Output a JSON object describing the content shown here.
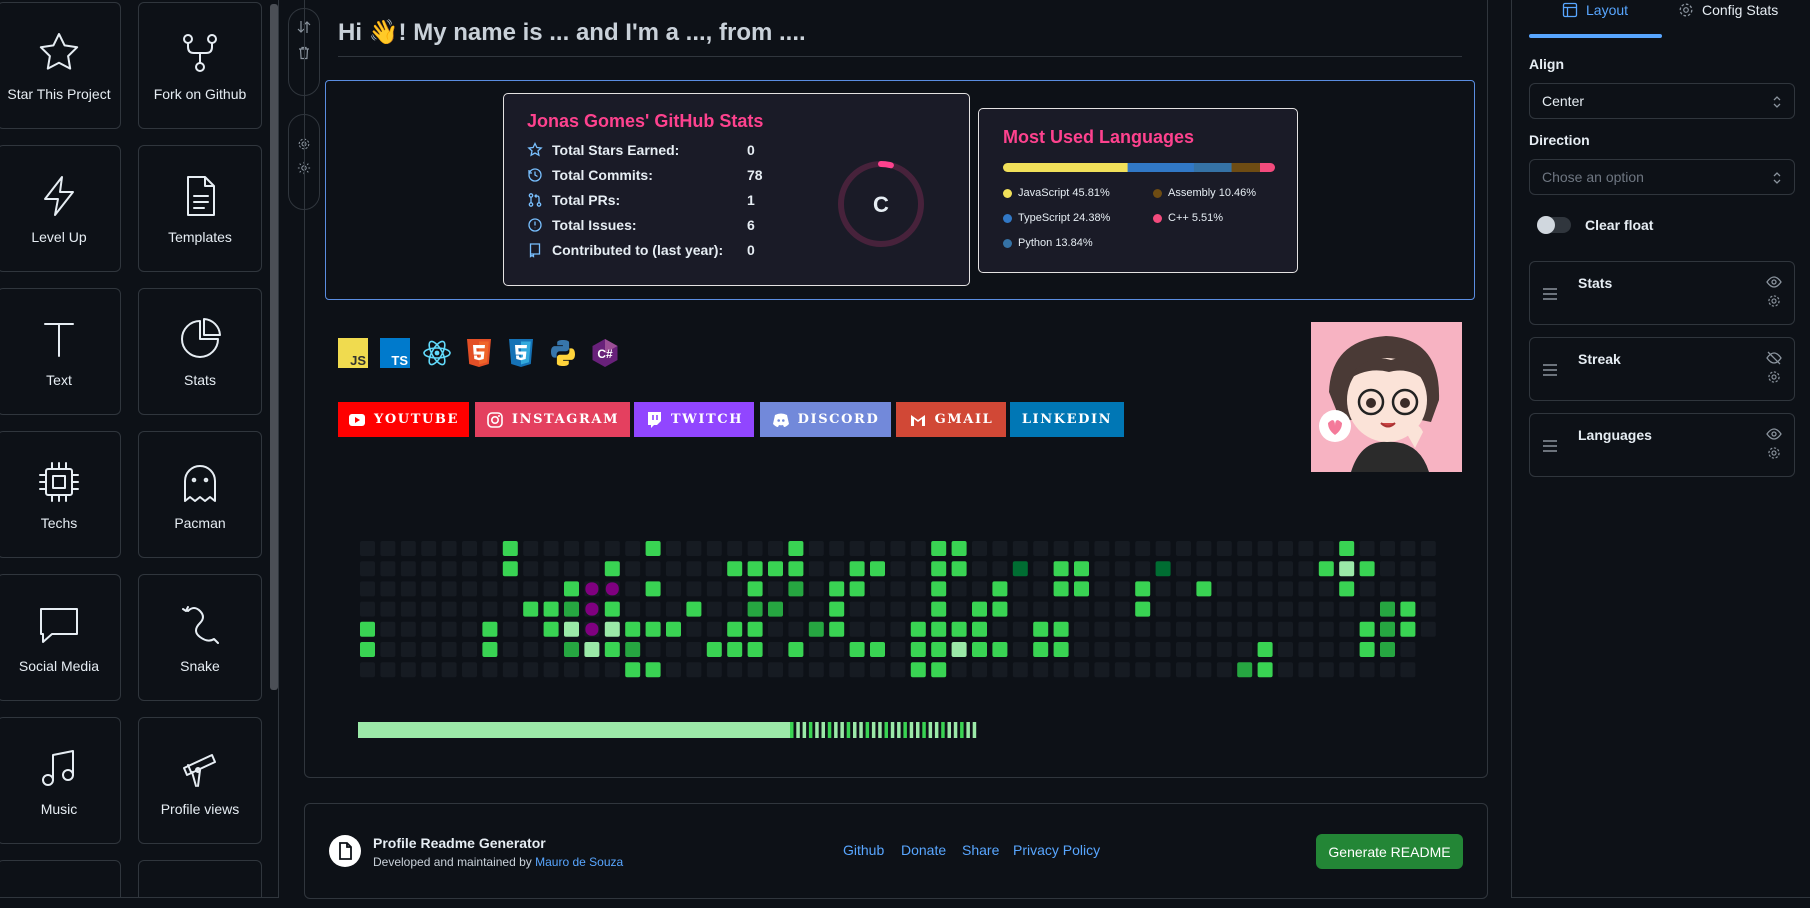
{
  "sidebar": {
    "items": [
      {
        "label": "Star This Project",
        "icon": "star-icon"
      },
      {
        "label": "Fork on Github",
        "icon": "git-fork-icon"
      },
      {
        "label": "Level Up",
        "icon": "lightning-icon"
      },
      {
        "label": "Templates",
        "icon": "document-icon"
      },
      {
        "label": "Text",
        "icon": "text-icon"
      },
      {
        "label": "Stats",
        "icon": "pie-chart-icon"
      },
      {
        "label": "Techs",
        "icon": "cpu-icon"
      },
      {
        "label": "Pacman",
        "icon": "ghost-icon"
      },
      {
        "label": "Social Media",
        "icon": "chat-bubble-icon"
      },
      {
        "label": "Snake",
        "icon": "snake-icon"
      },
      {
        "label": "Music",
        "icon": "music-note-icon"
      },
      {
        "label": "Profile views",
        "icon": "telescope-icon"
      }
    ]
  },
  "toolbar": {
    "icons": [
      "swap-vertical-icon",
      "trash-icon",
      "gear-icon",
      "sun-icon"
    ]
  },
  "main": {
    "heading": "Hi 👋! My name is ... and I'm a ..., from ....",
    "stats_card": {
      "title": "Jonas Gomes' GitHub Stats",
      "rows": [
        {
          "label": "Total Stars Earned:",
          "value": "0"
        },
        {
          "label": "Total Commits:",
          "value": "78"
        },
        {
          "label": "Total PRs:",
          "value": "1"
        },
        {
          "label": "Total Issues:",
          "value": "6"
        },
        {
          "label": "Contributed to (last year):",
          "value": "0"
        }
      ],
      "rank": "C",
      "rank_progress": 0.04
    },
    "languages_card": {
      "title": "Most Used Languages",
      "languages": [
        {
          "name": "JavaScript",
          "percent": "45.81%",
          "value": 45.81,
          "color": "#f1e05a"
        },
        {
          "name": "TypeScript",
          "percent": "24.38%",
          "value": 24.38,
          "color": "#3178c6"
        },
        {
          "name": "Python",
          "percent": "13.84%",
          "value": 13.84,
          "color": "#3572a5"
        },
        {
          "name": "Assembly",
          "percent": "10.46%",
          "value": 10.46,
          "color": "#6e4c13"
        },
        {
          "name": "C++",
          "percent": "5.51%",
          "value": 5.51,
          "color": "#f34b7d"
        }
      ]
    },
    "techs": [
      "javascript-icon",
      "typescript-icon",
      "react-icon",
      "html5-icon",
      "css3-icon",
      "python-icon",
      "csharp-icon"
    ],
    "tech_labels": {
      "js": "JS",
      "ts": "TS",
      "csharp": "C#"
    },
    "socials": [
      {
        "label": "YOUTUBE",
        "color": "#ff0000",
        "icon": "youtube-icon"
      },
      {
        "label": "INSTAGRAM",
        "color": "#e4405f",
        "icon": "instagram-icon"
      },
      {
        "label": "TWITCH",
        "color": "#9146ff",
        "icon": "twitch-icon"
      },
      {
        "label": "DISCORD",
        "color": "#7289da",
        "icon": "discord-icon"
      },
      {
        "label": "GMAIL",
        "color": "#d14836",
        "icon": "gmail-icon"
      },
      {
        "label": "LINKEDIN",
        "color": "#0077b5",
        "icon": ""
      }
    ]
  },
  "footer": {
    "app_name": "Profile Readme Generator",
    "credit_prefix": "Developed and maintained by ",
    "credit_name": "Mauro de Souza",
    "links": [
      "Github",
      "Donate",
      "Share",
      "Privacy Policy"
    ],
    "generate_label": "Generate README"
  },
  "right_panel": {
    "tabs": [
      {
        "label": "Layout",
        "icon": "layout-icon",
        "active": true
      },
      {
        "label": "Config Stats",
        "icon": "gear-icon",
        "active": false
      }
    ],
    "align_label": "Align",
    "align_value": "Center",
    "direction_label": "Direction",
    "direction_placeholder": "Chose an option",
    "clear_float_label": "Clear float",
    "clear_float_on": false,
    "blocks": [
      {
        "label": "Stats",
        "visible": true
      },
      {
        "label": "Streak",
        "visible": false
      },
      {
        "label": "Languages",
        "visible": true
      }
    ]
  },
  "colors": {
    "accent": "#58a6ff",
    "card_title": "#fe428e",
    "generate": "#238636"
  }
}
